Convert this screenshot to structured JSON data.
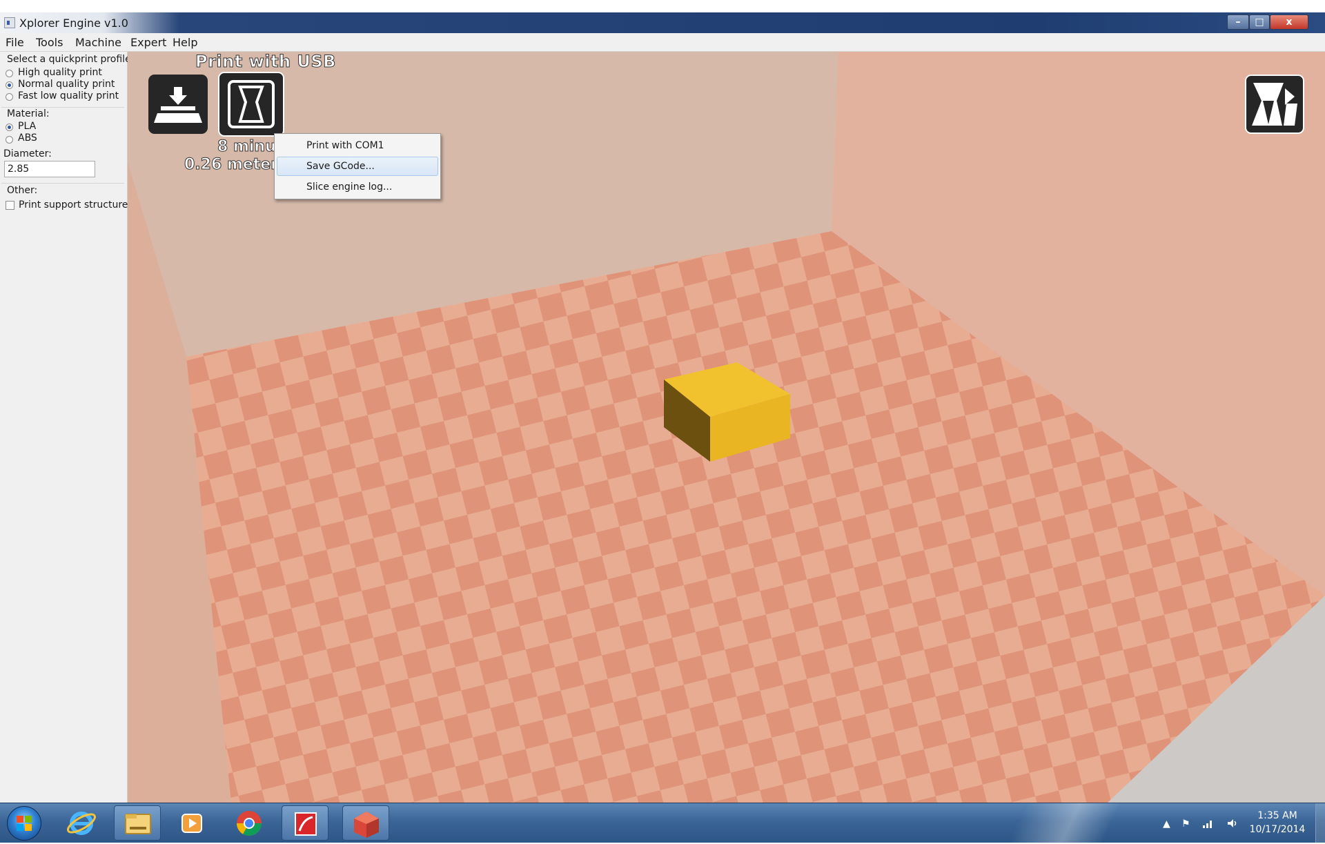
{
  "window": {
    "title": "Xplorer Engine v1.0",
    "controls": {
      "minimize": "–",
      "maximize": "□",
      "close": "x"
    }
  },
  "menubar": {
    "items": [
      "File",
      "Tools",
      "Machine",
      "Expert",
      "Help"
    ]
  },
  "sidebar": {
    "profile_heading": "Select a quickprint profile:",
    "profiles": [
      {
        "label": "High quality print",
        "checked": false
      },
      {
        "label": "Normal quality print",
        "checked": true
      },
      {
        "label": "Fast low quality print",
        "checked": false
      }
    ],
    "material_heading": "Material:",
    "materials": [
      {
        "label": "PLA",
        "checked": true
      },
      {
        "label": "ABS",
        "checked": false
      }
    ],
    "diameter_label": "Diameter:",
    "diameter_value": "2.85",
    "other_heading": "Other:",
    "support_label": "Print support structure",
    "support_checked": false
  },
  "viewport": {
    "print_with_usb_label": "Print with USB",
    "estimate_line1": "8 minut",
    "estimate_line2": "0.26 meter 2",
    "load_button_icon": "load-model-icon",
    "print_button_icon": "print-usb-icon",
    "view_mode_icon": "view-mode-icon",
    "floor_colors": {
      "light": "#e7ac92",
      "dark": "#df9379"
    },
    "object_color": "#ebb52a"
  },
  "context_menu": {
    "items": [
      "Print with COM1",
      "Save GCode...",
      "Slice engine log..."
    ],
    "highlighted_index": 1
  },
  "taskbar": {
    "pinned": [
      "start-orb",
      "internet-explorer-icon",
      "file-explorer-icon",
      "media-player-icon",
      "chrome-icon",
      "pdf-app-icon",
      "xplorer-engine-icon"
    ],
    "time": "1:35 AM",
    "date": "10/17/2014",
    "tray_icons": [
      "show-hidden-icons-arrow",
      "action-center-flag-icon",
      "network-signal-icon",
      "volume-icon"
    ]
  }
}
